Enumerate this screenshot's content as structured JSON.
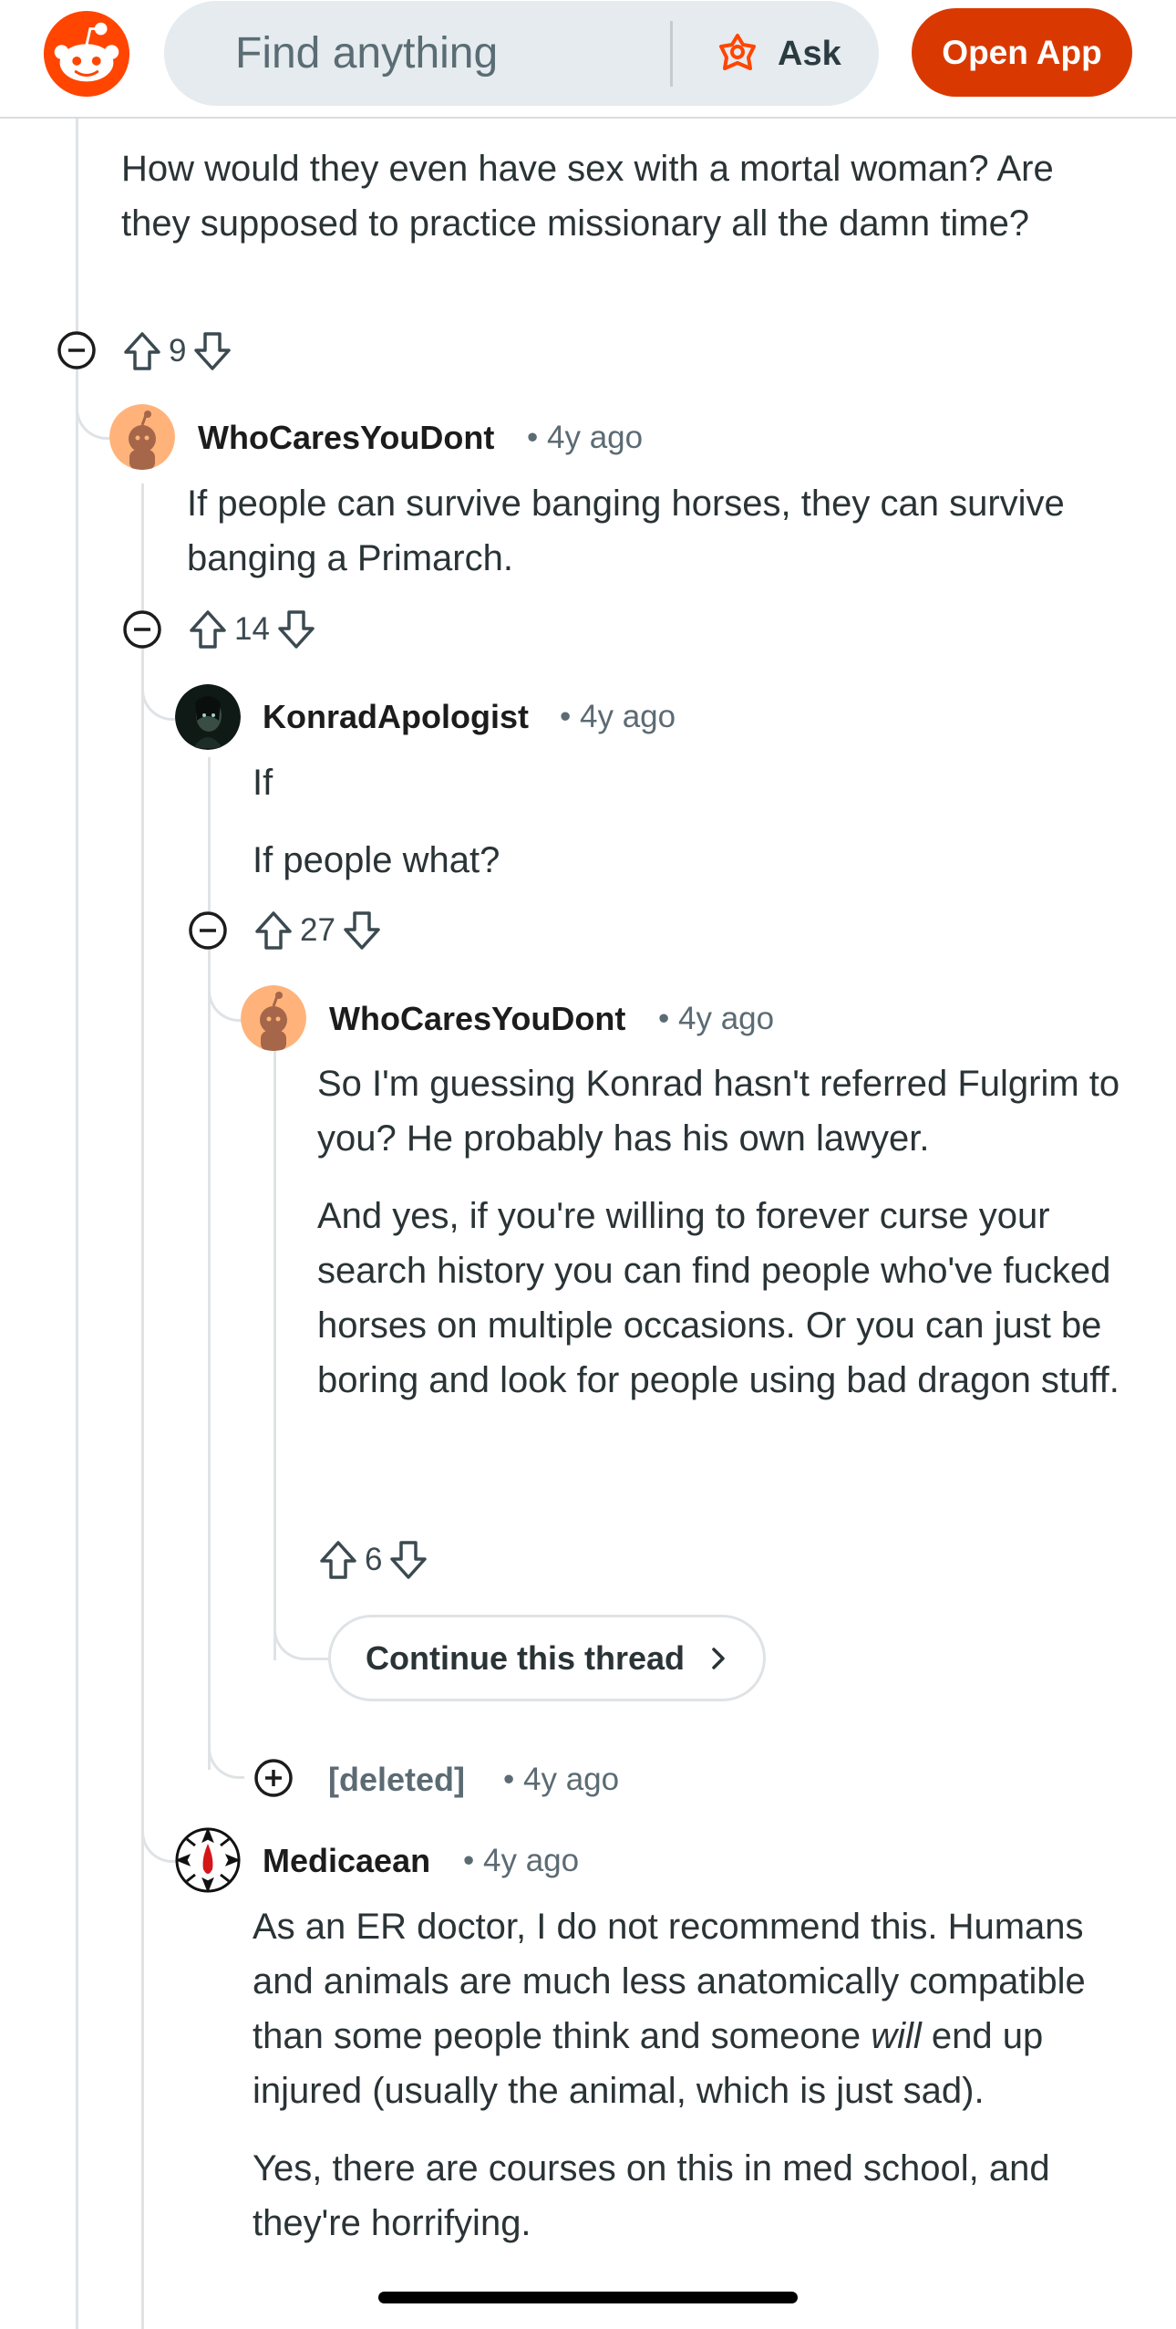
{
  "header": {
    "search_placeholder": "Find anything",
    "ask_label": "Ask",
    "open_app_label": "Open App"
  },
  "comments": {
    "root": {
      "body": [
        "How would they even have sex with a mortal woman? Are they supposed to practice missionary all the damn time?"
      ],
      "score": "9"
    },
    "c1": {
      "username": "WhoCaresYouDont",
      "time": "4y ago",
      "body": [
        "If people can survive banging horses, they can survive banging a Primarch."
      ],
      "score": "14"
    },
    "c2": {
      "username": "KonradApologist",
      "time": "4y ago",
      "body": [
        "If",
        "If people what?"
      ],
      "score": "27"
    },
    "c3": {
      "username": "WhoCaresYouDont",
      "time": "4y ago",
      "body": [
        "So I'm guessing Konrad hasn't referred Fulgrim to you? He probably has his own lawyer.",
        "And yes, if you're willing to forever curse your search history you can find people who've fucked horses on multiple occasions. Or you can just be boring and look for people using bad dragon stuff."
      ],
      "score": "6",
      "continue_label": "Continue this thread"
    },
    "deleted": {
      "username": "[deleted]",
      "time": "4y ago"
    },
    "c4": {
      "username": "Medicaean",
      "time": "4y ago",
      "body_p1_a": "As an ER doctor, I do not recommend this. Humans and animals are much less anatomically compatible than some people think and someone ",
      "body_p1_em": "will",
      "body_p1_b": " end up injured (usually the animal, which is just sad).",
      "body_p2": "Yes, there are courses on this in med school, and they're horrifying."
    }
  },
  "separator": "•",
  "colors": {
    "brand": "#ff4500",
    "button": "#d93900",
    "thread_line": "#dfe3e6"
  },
  "icons": [
    "reddit-logo-icon",
    "ask-icon",
    "upvote-icon",
    "downvote-icon",
    "collapse-icon",
    "expand-icon",
    "chevron-right-icon"
  ]
}
